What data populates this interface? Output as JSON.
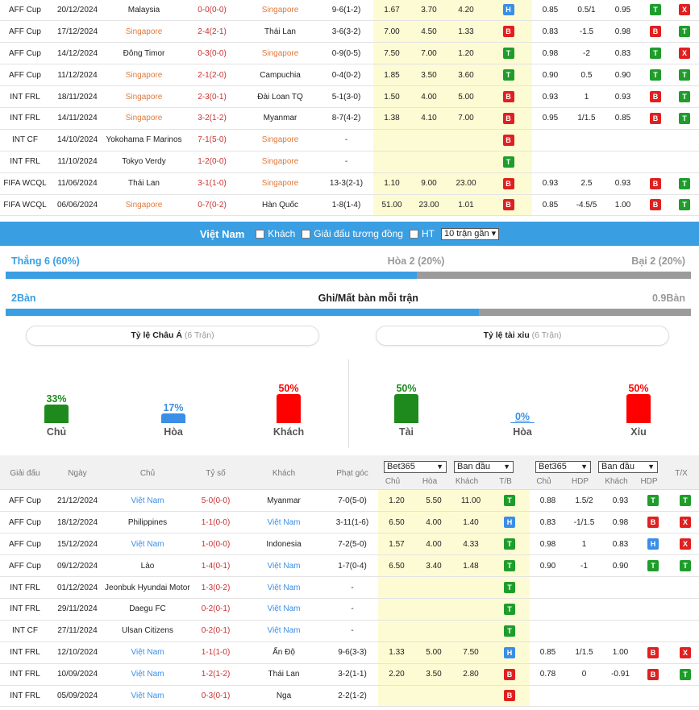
{
  "top_rows": [
    {
      "league": "AFF Cup",
      "date": "20/12/2024",
      "home": "Malaysia",
      "score": "0-0(0-0)",
      "away": "Singapore",
      "corner": "9-6(1-2)",
      "o1": "1.67",
      "o2": "3.70",
      "o3": "4.20",
      "r1": "H",
      "h1": "0.85",
      "h2": "0.5/1",
      "h3": "0.95",
      "r2": "T",
      "r3": "X",
      "hl": "away"
    },
    {
      "league": "AFF Cup",
      "date": "17/12/2024",
      "home": "Singapore",
      "score": "2-4(2-1)",
      "away": "Thái Lan",
      "corner": "3-6(3-2)",
      "o1": "7.00",
      "o2": "4.50",
      "o3": "1.33",
      "r1": "B",
      "h1": "0.83",
      "h2": "-1.5",
      "h3": "0.98",
      "r2": "B",
      "r3": "T",
      "hl": "home"
    },
    {
      "league": "AFF Cup",
      "date": "14/12/2024",
      "home": "Đông Timor",
      "score": "0-3(0-0)",
      "away": "Singapore",
      "corner": "0-9(0-5)",
      "o1": "7.50",
      "o2": "7.00",
      "o3": "1.20",
      "r1": "T",
      "h1": "0.98",
      "h2": "-2",
      "h3": "0.83",
      "r2": "T",
      "r3": "X",
      "hl": "away"
    },
    {
      "league": "AFF Cup",
      "date": "11/12/2024",
      "home": "Singapore",
      "score": "2-1(2-0)",
      "away": "Campuchia",
      "corner": "0-4(0-2)",
      "o1": "1.85",
      "o2": "3.50",
      "o3": "3.60",
      "r1": "T",
      "h1": "0.90",
      "h2": "0.5",
      "h3": "0.90",
      "r2": "T",
      "r3": "T",
      "hl": "home"
    },
    {
      "league": "INT FRL",
      "date": "18/11/2024",
      "home": "Singapore",
      "score": "2-3(0-1)",
      "away": "Đài Loan TQ",
      "corner": "5-1(3-0)",
      "o1": "1.50",
      "o2": "4.00",
      "o3": "5.00",
      "r1": "B",
      "h1": "0.93",
      "h2": "1",
      "h3": "0.93",
      "r2": "B",
      "r3": "T",
      "hl": "home"
    },
    {
      "league": "INT FRL",
      "date": "14/11/2024",
      "home": "Singapore",
      "score": "3-2(1-2)",
      "away": "Myanmar",
      "corner": "8-7(4-2)",
      "o1": "1.38",
      "o2": "4.10",
      "o3": "7.00",
      "r1": "B",
      "h1": "0.95",
      "h2": "1/1.5",
      "h3": "0.85",
      "r2": "B",
      "r3": "T",
      "hl": "home"
    },
    {
      "league": "INT CF",
      "date": "14/10/2024",
      "home": "Yokohama F Marinos",
      "score": "7-1(5-0)",
      "away": "Singapore",
      "corner": "-",
      "o1": "",
      "o2": "",
      "o3": "",
      "r1": "B",
      "h1": "",
      "h2": "",
      "h3": "",
      "r2": "",
      "r3": "",
      "hl": "away"
    },
    {
      "league": "INT FRL",
      "date": "11/10/2024",
      "home": "Tokyo Verdy",
      "score": "1-2(0-0)",
      "away": "Singapore",
      "corner": "-",
      "o1": "",
      "o2": "",
      "o3": "",
      "r1": "T",
      "h1": "",
      "h2": "",
      "h3": "",
      "r2": "",
      "r3": "",
      "hl": "away"
    },
    {
      "league": "FIFA WCQL",
      "date": "11/06/2024",
      "home": "Thái Lan",
      "score": "3-1(1-0)",
      "away": "Singapore",
      "corner": "13-3(2-1)",
      "o1": "1.10",
      "o2": "9.00",
      "o3": "23.00",
      "r1": "B",
      "h1": "0.93",
      "h2": "2.5",
      "h3": "0.93",
      "r2": "B",
      "r3": "T",
      "hl": "away"
    },
    {
      "league": "FIFA WCQL",
      "date": "06/06/2024",
      "home": "Singapore",
      "score": "0-7(0-2)",
      "away": "Hàn Quốc",
      "corner": "1-8(1-4)",
      "o1": "51.00",
      "o2": "23.00",
      "o3": "1.01",
      "r1": "B",
      "h1": "0.85",
      "h2": "-4.5/5",
      "h3": "1.00",
      "r2": "B",
      "r3": "T",
      "hl": "home"
    }
  ],
  "filter": {
    "team": "Việt Nam",
    "away_label": "Khách",
    "same_league_label": "Giải đấu tương đồng",
    "ht_label": "HT",
    "recent_select": "10 trận gần"
  },
  "summary": {
    "win": "Thắng 6 (60%)",
    "draw": "Hòa 2 (20%)",
    "loss": "Bại 2 (20%)",
    "win_fraction": 0.6,
    "goals_for": "2Bàn",
    "goals_title": "Ghi/Mất bàn mỗi trận",
    "goals_against": "0.9Bàn",
    "goals_fraction": 0.69
  },
  "asian": {
    "title": "Tỷ lệ Châu Á",
    "count": "(6 Trận)",
    "cols": [
      {
        "pct": "33%",
        "label": "Chủ",
        "value": 0.33,
        "color": "#1e8a1e"
      },
      {
        "pct": "17%",
        "label": "Hòa",
        "value": 0.17,
        "color": "#3a8ee6"
      },
      {
        "pct": "50%",
        "label": "Khách",
        "value": 0.5,
        "color": "#ff0000"
      }
    ]
  },
  "overunder": {
    "title": "Tỷ lệ tài xỉu",
    "count": "(6 Trận)",
    "cols": [
      {
        "pct": "50%",
        "label": "Tài",
        "value": 0.5,
        "color": "#1e8a1e"
      },
      {
        "pct": "0%",
        "label": "Hòa",
        "value": 0.0,
        "color": "#3a8ee6"
      },
      {
        "pct": "50%",
        "label": "Xỉu",
        "value": 0.5,
        "color": "#ff0000"
      }
    ]
  },
  "header": {
    "league": "Giải đấu",
    "date": "Ngày",
    "home": "Chủ",
    "score": "Tỷ số",
    "away": "Khách",
    "corner": "Phạt góc",
    "book1": "Bet365",
    "type1": "Ban đầu",
    "book2": "Bet365",
    "type2": "Ban đầu",
    "s_home": "Chủ",
    "s_draw": "Hòa",
    "s_away": "Khách",
    "s_tb": "T/B",
    "s_home2": "Chủ",
    "s_hdp": "HDP",
    "s_away2": "Khách",
    "s_hdp2": "HDP",
    "s_tx": "T/X"
  },
  "bottom_rows": [
    {
      "league": "AFF Cup",
      "date": "21/12/2024",
      "home": "Việt Nam",
      "score": "5-0(0-0)",
      "away": "Myanmar",
      "corner": "7-0(5-0)",
      "o1": "1.20",
      "o2": "5.50",
      "o3": "11.00",
      "r1": "T",
      "h1": "0.88",
      "h2": "1.5/2",
      "h3": "0.93",
      "r2": "T",
      "r3": "T",
      "hl": "home"
    },
    {
      "league": "AFF Cup",
      "date": "18/12/2024",
      "home": "Philippines",
      "score": "1-1(0-0)",
      "away": "Việt Nam",
      "corner": "3-11(1-6)",
      "o1": "6.50",
      "o2": "4.00",
      "o3": "1.40",
      "r1": "H",
      "h1": "0.83",
      "h2": "-1/1.5",
      "h3": "0.98",
      "r2": "B",
      "r3": "X",
      "hl": "away"
    },
    {
      "league": "AFF Cup",
      "date": "15/12/2024",
      "home": "Việt Nam",
      "score": "1-0(0-0)",
      "away": "Indonesia",
      "corner": "7-2(5-0)",
      "o1": "1.57",
      "o2": "4.00",
      "o3": "4.33",
      "r1": "T",
      "h1": "0.98",
      "h2": "1",
      "h3": "0.83",
      "r2": "H",
      "r3": "X",
      "hl": "home"
    },
    {
      "league": "AFF Cup",
      "date": "09/12/2024",
      "home": "Lào",
      "score": "1-4(0-1)",
      "away": "Việt Nam",
      "corner": "1-7(0-4)",
      "o1": "6.50",
      "o2": "3.40",
      "o3": "1.48",
      "r1": "T",
      "h1": "0.90",
      "h2": "-1",
      "h3": "0.90",
      "r2": "T",
      "r3": "T",
      "hl": "away"
    },
    {
      "league": "INT FRL",
      "date": "01/12/2024",
      "home": "Jeonbuk Hyundai Motors",
      "score": "1-3(0-2)",
      "away": "Việt Nam",
      "corner": "-",
      "o1": "",
      "o2": "",
      "o3": "",
      "r1": "T",
      "h1": "",
      "h2": "",
      "h3": "",
      "r2": "",
      "r3": "",
      "hl": "away"
    },
    {
      "league": "INT FRL",
      "date": "29/11/2024",
      "home": "Daegu FC",
      "score": "0-2(0-1)",
      "away": "Việt Nam",
      "corner": "-",
      "o1": "",
      "o2": "",
      "o3": "",
      "r1": "T",
      "h1": "",
      "h2": "",
      "h3": "",
      "r2": "",
      "r3": "",
      "hl": "away"
    },
    {
      "league": "INT CF",
      "date": "27/11/2024",
      "home": "Ulsan Citizens",
      "score": "0-2(0-1)",
      "away": "Việt Nam",
      "corner": "-",
      "o1": "",
      "o2": "",
      "o3": "",
      "r1": "T",
      "h1": "",
      "h2": "",
      "h3": "",
      "r2": "",
      "r3": "",
      "hl": "away"
    },
    {
      "league": "INT FRL",
      "date": "12/10/2024",
      "home": "Việt Nam",
      "score": "1-1(1-0)",
      "away": "Ấn Độ",
      "corner": "9-6(3-3)",
      "o1": "1.33",
      "o2": "5.00",
      "o3": "7.50",
      "r1": "H",
      "h1": "0.85",
      "h2": "1/1.5",
      "h3": "1.00",
      "r2": "B",
      "r3": "X",
      "hl": "home"
    },
    {
      "league": "INT FRL",
      "date": "10/09/2024",
      "home": "Việt Nam",
      "score": "1-2(1-2)",
      "away": "Thái Lan",
      "corner": "3-2(1-1)",
      "o1": "2.20",
      "o2": "3.50",
      "o3": "2.80",
      "r1": "B",
      "h1": "0.78",
      "h2": "0",
      "h3": "-0.91",
      "r2": "B",
      "r3": "T",
      "hl": "home"
    },
    {
      "league": "INT FRL",
      "date": "05/09/2024",
      "home": "Việt Nam",
      "score": "0-3(0-1)",
      "away": "Nga",
      "corner": "2-2(1-2)",
      "o1": "",
      "o2": "",
      "o3": "",
      "r1": "B",
      "h1": "",
      "h2": "",
      "h3": "",
      "r2": "",
      "r3": "",
      "hl": "home"
    }
  ]
}
